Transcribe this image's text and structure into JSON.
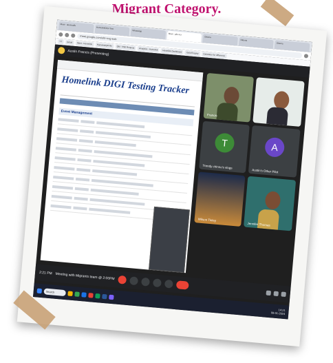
{
  "heading": "Migrant Category.",
  "browser": {
    "tabs": [
      "Meet - dexmadfs",
      "HomelinkDIGI Test",
      "WhatsApp",
      "Meet - pfiz-ncr",
      "Okteria",
      "Okteria",
      "Okteria"
    ],
    "url": "meet.google.com/ohl-rcrg-eob",
    "bookmarks": [
      "YT",
      "Gmail",
      "Meet - Homelink",
      "HomelinkQM Re",
      "QM - HSE Request",
      "Analytics - Homelink",
      "Homelink Dashboard",
      "Gold Enquiry",
      "Calculator for difference"
    ]
  },
  "meet": {
    "presenter": "Austin Francis (Presenting)",
    "time": "2:21 PM",
    "meeting_title": "Meeting with Migrants team @ 2:00PM"
  },
  "sheet": {
    "title": "Homelink DIGI Testing Tracker",
    "section": "Event Management"
  },
  "participants": [
    {
      "name": "Francis",
      "type": "photo"
    },
    {
      "name": "",
      "type": "photo"
    },
    {
      "name": "Trendy chinno's vlogs",
      "initial": "T",
      "color": "#3d8b37"
    },
    {
      "name": "Austin's Other Pilot",
      "initial": "A",
      "color": "#6a47c8"
    },
    {
      "name": "Wilson Tinley",
      "type": "landscape"
    },
    {
      "name": "Jennifer Thomas",
      "type": "photo2"
    }
  ],
  "taskbar": {
    "search_placeholder": "Search",
    "clock_time": "14:21",
    "clock_date": "08-01-2024"
  }
}
